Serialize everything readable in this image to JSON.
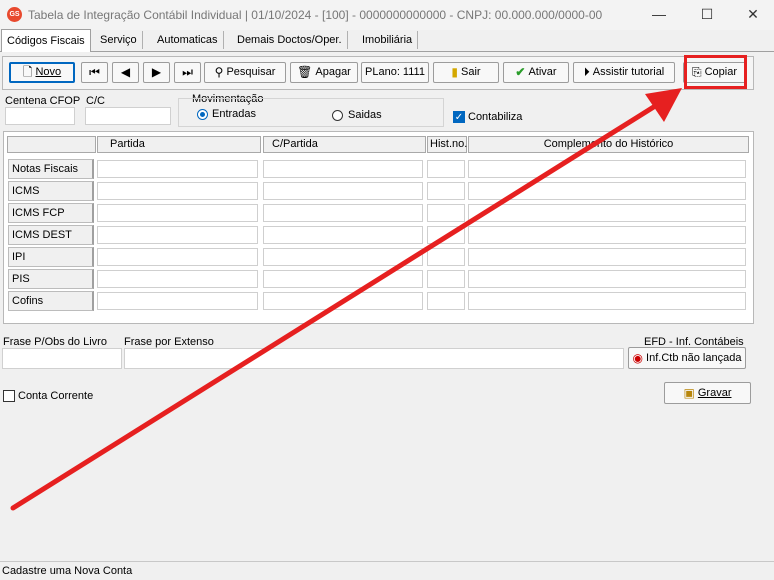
{
  "window": {
    "app_icon": "GS",
    "title": "Tabela de Integração Contábil Individual   | 01/10/2024 - [100] - 0000000000000 - CNPJ: 00.000.000/0000-00",
    "minimize_glyph": "—",
    "maximize_glyph": "☐",
    "close_glyph": "✕"
  },
  "tabs": [
    {
      "label": "Códigos Fiscais"
    },
    {
      "label": "Serviço"
    },
    {
      "label": "Automaticas"
    },
    {
      "label": "Demais Doctos/Oper."
    },
    {
      "label": "Imobiliária"
    }
  ],
  "toolbar": {
    "novo": "Novo",
    "pesquisar": "Pesquisar",
    "apagar": "Apagar",
    "plano": "PLano: 1111",
    "sair": "Sair",
    "ativar": "Ativar",
    "assistir": "Assistir tutorial",
    "copiar": "Copiar",
    "icons": {
      "novo": "page-icon",
      "first": "first-icon",
      "prev": "prev-icon",
      "next": "next-icon",
      "last": "last-icon",
      "pesquisar": "binoculars-icon",
      "apagar": "trash-icon",
      "sair": "exit-door-icon",
      "ativar": "checkmark-icon",
      "assistir": "play-icon",
      "copiar": "copy-icon"
    }
  },
  "form": {
    "centena_label": "Centena CFOP",
    "cc_label": "C/C",
    "movimentacao_label": "Movimentação",
    "entradas_label": "Entradas",
    "saidas_label": "Saidas",
    "contabiliza_label": "Contabiliza",
    "selected_movimentacao": "Entradas",
    "contabiliza_checked": true
  },
  "grid": {
    "columns": [
      "Partida",
      "C/Partida",
      "Hist.no.",
      "Complemento do Histórico"
    ],
    "rows": [
      {
        "label": "Notas Fiscais"
      },
      {
        "label": "ICMS"
      },
      {
        "label": "ICMS FCP"
      },
      {
        "label": "ICMS DEST"
      },
      {
        "label": "IPI"
      },
      {
        "label": "PIS"
      },
      {
        "label": "Cofins"
      }
    ]
  },
  "bottom": {
    "frase_obs_label": "Frase P/Obs do Livro",
    "frase_extenso_label": "Frase por Extenso",
    "efd_label": "EFD - Inf. Contábeis",
    "infctb_button": "Inf.Ctb não lançada",
    "conta_corrente_label": "Conta Corrente",
    "gravar_button": "Gravar"
  },
  "status": {
    "text": "Cadastre uma Nova Conta"
  },
  "colors": {
    "annotation_red": "#e62020",
    "accent_blue": "#0067c0"
  }
}
